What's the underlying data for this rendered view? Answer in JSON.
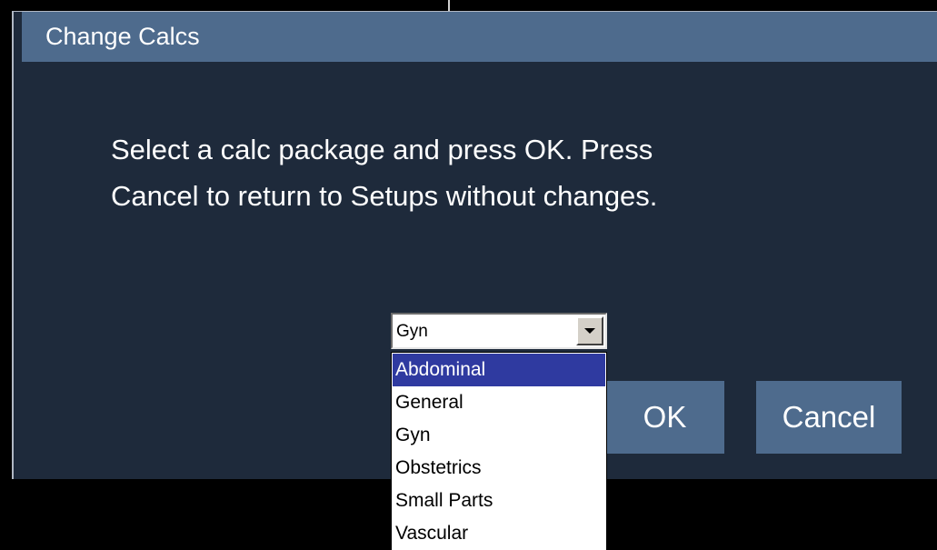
{
  "dialog": {
    "title": "Change Calcs",
    "message_line1": "Select a calc package and press OK. Press",
    "message_line2": "Cancel to return to Setups without changes."
  },
  "combo": {
    "selected_value": "Gyn",
    "options": [
      "Abdominal",
      "General",
      "Gyn",
      "Obstetrics",
      "Small Parts",
      "Vascular"
    ],
    "highlighted_option": "Abdominal"
  },
  "buttons": {
    "ok_label": "OK",
    "cancel_label": "Cancel"
  },
  "colors": {
    "dialog_background": "#1e2a3b",
    "titlebar": "#4e6b8d",
    "button": "#4e6b8d",
    "list_highlight": "#2f3aa0"
  },
  "icons": {
    "combo_arrow": "chevron-down-icon"
  }
}
